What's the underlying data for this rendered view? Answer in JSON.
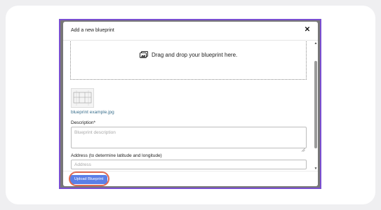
{
  "modal": {
    "title": "Add a new blueprint",
    "close_icon": "close-icon",
    "close_label": "✕"
  },
  "dropzone": {
    "icon": "image-gallery-icon",
    "label": "Drag and drop your blueprint here."
  },
  "preview": {
    "icon": "blueprint-thumbnail",
    "filename": "blueprint example.jpg"
  },
  "description": {
    "label": "Description*",
    "placeholder": "Blueprint description",
    "value": ""
  },
  "address": {
    "label": "Address (to determine latitude and longitude)",
    "placeholder": "Address",
    "value": ""
  },
  "footer": {
    "upload_label": "Upload Blueprint"
  },
  "colors": {
    "accent": "#5b7fe6",
    "frame": "#7a4fd1",
    "highlight": "#e06a52",
    "filename": "#3a6f8c"
  }
}
